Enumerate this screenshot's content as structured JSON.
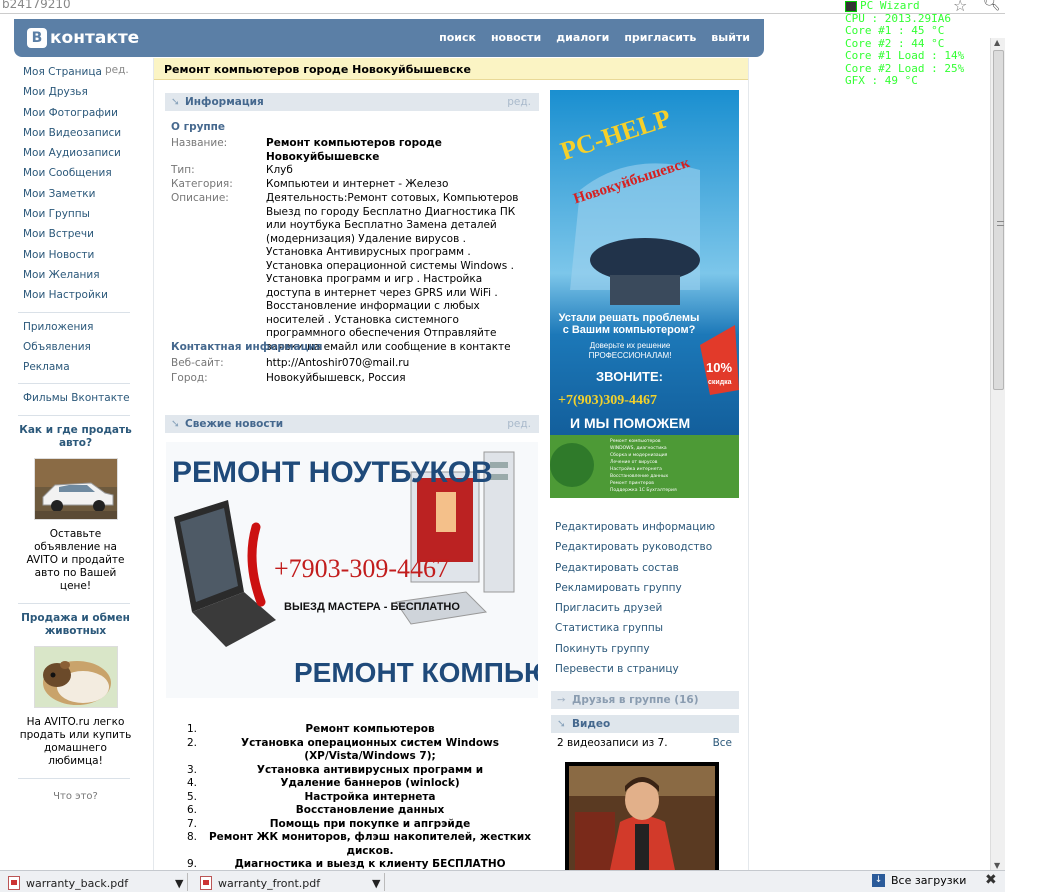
{
  "url_text": "b24179210",
  "pc_wizard": {
    "title": "PC Wizard",
    "lines": [
      "CPU : 2013.29IA6",
      "Core #1 : 45 °C",
      "Core #2 : 44 °C",
      "Core #1 Load : 14%",
      "Core #2 Load : 25%",
      "GFX : 49 °C"
    ]
  },
  "header": {
    "logo_letter": "B",
    "logo_text": "контакте",
    "nav": [
      "поиск",
      "новости",
      "диалоги",
      "пригласить",
      "выйти"
    ]
  },
  "left_menu": {
    "edit_label": "ред.",
    "group1": [
      "Моя Страница",
      "Мои Друзья",
      "Мои Фотографии",
      "Мои Видеозаписи",
      "Мои Аудиозаписи",
      "Мои Сообщения",
      "Мои Заметки",
      "Мои Группы",
      "Мои Встречи",
      "Мои Новости",
      "Мои Желания",
      "Мои Настройки"
    ],
    "group2": [
      "Приложения",
      "Объявления",
      "Реклама"
    ],
    "group3": [
      "Фильмы Вконтакте"
    ],
    "ad1": {
      "title": "Как и где продать авто?",
      "text": "Оставьте объявление на AVITO и продайте авто по Вашей цене!"
    },
    "ad2": {
      "title": "Продажа и обмен животных",
      "text": "На AVITO.ru легко продать или купить домашнего любимца!"
    },
    "what": "Что это?"
  },
  "group": {
    "title": "Ремонт компьютеров городе Новокуйбышевске",
    "info_section": "Информация",
    "edit": "ред.",
    "about_header": "О группе",
    "name_label": "Название:",
    "name_value": "Ремонт компьютеров городе Новокуйбышевске",
    "type_label": "Тип:",
    "type_value": "Клуб",
    "category_label": "Категория:",
    "category_value": "Компьютеи и интернет - Железо",
    "desc_label": "Описание:",
    "desc_value": "Деятельность:Ремонт сотовых, Компьютеров Выезд по городу Бесплатно Диагностика ПК или ноутбука Бесплатно Замена деталей (модернизация) Удаление вирусов . Установка Антивирусных программ . Установка операционной системы Windows . Установка программ и игр . Настройка доступа в интернет через GPRS или WiFi . Восстановление информации с любых носителей . Установка системного программного обеспечения Отправляйте заявки на емайл или сообщение в контакте",
    "contact_header": "Контактная информация",
    "site_label": "Веб-сайт:",
    "site_value": "http://Antoshir070@mail.ru",
    "city_label": "Город:",
    "city_value": "Новокуйбышевск, Россия",
    "news_section": "Свежие новости",
    "news_image": {
      "line1": "РЕМОНТ НОУТБУКОВ",
      "phone": "+7903-309-4467",
      "line2": "ВЫЕЗД МАСТЕРА - БЕСПЛАТНО",
      "line3": "РЕМОНТ КОМПЬЮТЕРОВ"
    },
    "services": [
      "Ремонт компьютеров",
      "Установка операционных систем Windows (XP/Vista/Windows 7);",
      "Установка антивирусных программ и",
      "Удаление баннеров (winlock)",
      "Настройка интернета",
      "Восстановление данных",
      "Помощь при покупке и апгрэйде",
      "Ремонт ЖК мониторов, флэш накопителей, жестких дисков.",
      "Диагностика и выезд к клиенту БЕСПЛАТНО"
    ]
  },
  "banner": {
    "title": "PC-HELP",
    "subtitle": "Новокуйбышевск",
    "tired": "Устали решать проблемы с Вашим компьютером?",
    "trust": "Доверьте их решение ПРОФЕССИОНАЛАМ!",
    "call": "ЗВОНИТЕ:",
    "phone": "+7(903)309-4467",
    "help": "И МЫ ПОМОЖЕМ",
    "discount": "10%",
    "discount_label": "скидка",
    "bullets": [
      "Ремонт компьютеров",
      "WINDOWS, диагностика",
      "Сборка и модернизация",
      "Лечение от вирусов",
      "Настройка интернета",
      "Восстановление данных",
      "Ремонт принтеров",
      "Поддержка 1С Бухгалтерия"
    ]
  },
  "right_links": [
    "Редактировать информацию",
    "Редактировать руководство",
    "Редактировать состав",
    "Рекламировать группу",
    "Пригласить друзей",
    "Статистика группы",
    "Покинуть группу",
    "Перевести в страницу"
  ],
  "friends_bar": "Друзья в группе (16)",
  "video_bar": "Видео",
  "video_count": "2 видеозаписи из 7.",
  "video_all": "Все",
  "downloads": {
    "item1": "warranty_back.pdf",
    "item2": "warranty_front.pdf",
    "all": "Все загрузки"
  }
}
